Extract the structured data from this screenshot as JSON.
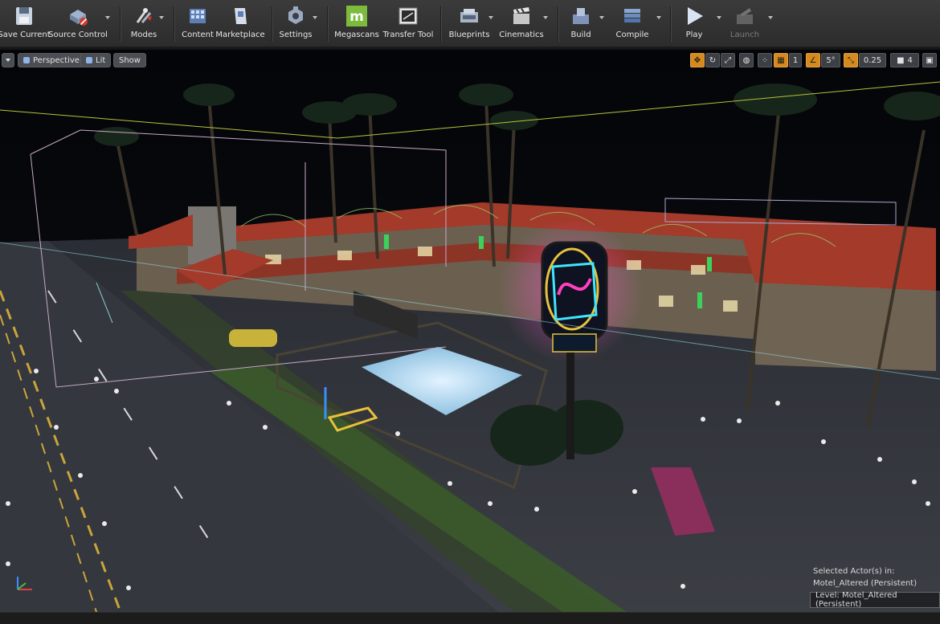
{
  "toolbar": {
    "items": [
      {
        "label": "Save Current",
        "icon": "save-icon"
      },
      {
        "label": "Source Control",
        "icon": "source-control-icon"
      },
      {
        "label": "Modes",
        "icon": "modes-icon"
      },
      {
        "label": "Content",
        "icon": "content-icon"
      },
      {
        "label": "Marketplace",
        "icon": "marketplace-icon"
      },
      {
        "label": "Settings",
        "icon": "settings-icon"
      },
      {
        "label": "Megascans",
        "icon": "megascans-icon",
        "glyph": "m"
      },
      {
        "label": "Transfer Tool",
        "icon": "transfer-tool-icon"
      },
      {
        "label": "Blueprints",
        "icon": "blueprints-icon"
      },
      {
        "label": "Cinematics",
        "icon": "cinematics-icon"
      },
      {
        "label": "Build",
        "icon": "build-icon"
      },
      {
        "label": "Compile",
        "icon": "compile-icon"
      },
      {
        "label": "Play",
        "icon": "play-icon"
      },
      {
        "label": "Launch",
        "icon": "launch-icon",
        "disabled": true
      }
    ]
  },
  "viewport": {
    "perspective_label": "Perspective",
    "lit_label": "Lit",
    "show_label": "Show",
    "controls": {
      "snap_value": "1",
      "angle_value": "5°",
      "scale_value": "0.25",
      "camera_speed": "4"
    },
    "selected_actors_line1": "Selected Actor(s) in:",
    "selected_actors_line2": "Motel_Altered (Persistent)",
    "level_label": "Level:  Motel_Altered (Persistent)"
  },
  "colors": {
    "toolbar_bg": "#333333",
    "accent_orange": "#d58a20",
    "megascans_green": "#7dbb3c",
    "neon_pink": "#ff3fbf",
    "neon_cyan": "#3ee6ff",
    "roof_red": "#a33a2a",
    "pool_blue": "#9fd2f0"
  }
}
